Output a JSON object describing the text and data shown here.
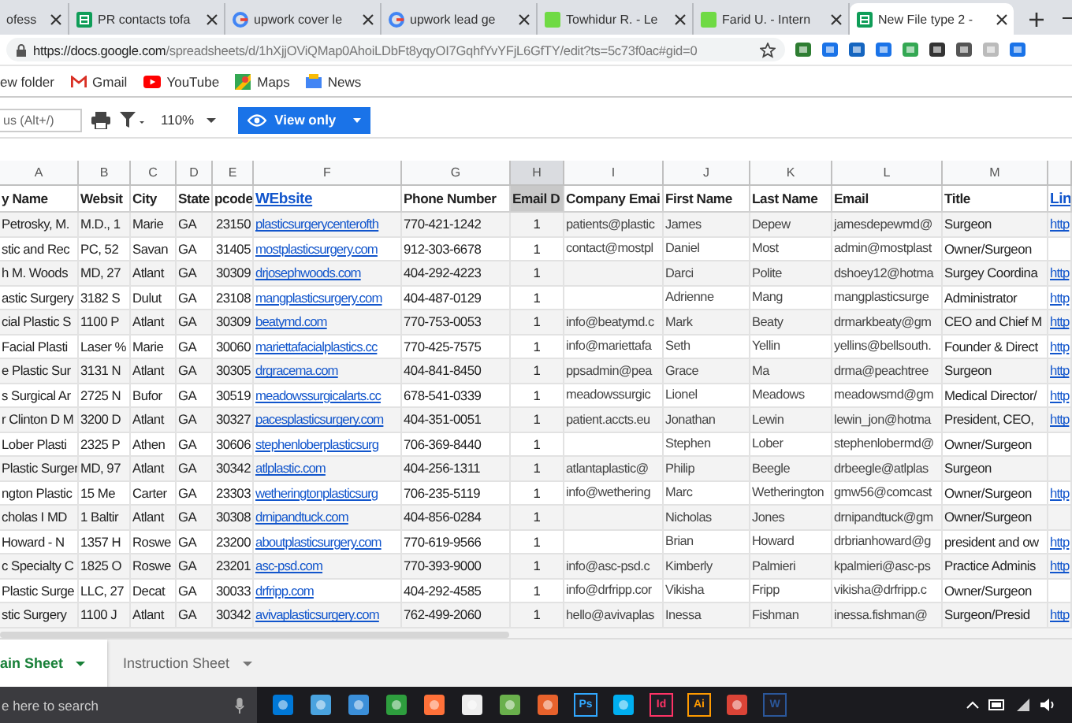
{
  "browser": {
    "tabs": [
      {
        "title": "ofess",
        "kind": "none",
        "selected": false
      },
      {
        "title": "PR contacts tofa",
        "kind": "sheets",
        "selected": false
      },
      {
        "title": "upwork cover le",
        "kind": "google",
        "selected": false
      },
      {
        "title": "upwork lead ge",
        "kind": "google",
        "selected": false
      },
      {
        "title": "Towhidur R. - Le",
        "kind": "upwork",
        "selected": false
      },
      {
        "title": "Farid U. - Intern",
        "kind": "upwork",
        "selected": false
      },
      {
        "title": "New File type 2 -",
        "kind": "sheets",
        "selected": true
      }
    ],
    "url_host": "https://docs.google.com",
    "url_path": "/spreadsheets/d/1hXjjOViQMap0AhoiLDbFt8yqyOI7GqhfYvYFjL6GfTY/edit?ts=5c73f0ac#gid=0",
    "bookmarks": [
      {
        "label": "ew folder",
        "kind": "none"
      },
      {
        "label": "Gmail",
        "kind": "gmail"
      },
      {
        "label": "YouTube",
        "kind": "youtube"
      },
      {
        "label": "Maps",
        "kind": "maps"
      },
      {
        "label": "News",
        "kind": "news"
      }
    ]
  },
  "toolbar": {
    "search_placeholder": "us (Alt+/)",
    "zoom": "110%",
    "view_button": "View only"
  },
  "sheet": {
    "columns": [
      {
        "letter": "A",
        "heading": "y Name",
        "kind": "text",
        "selected": false
      },
      {
        "letter": "B",
        "heading": "Websit",
        "kind": "text",
        "selected": false
      },
      {
        "letter": "C",
        "heading": "City",
        "kind": "text",
        "selected": false
      },
      {
        "letter": "D",
        "heading": "State",
        "kind": "text",
        "selected": false
      },
      {
        "letter": "E",
        "heading": "pcode",
        "kind": "number",
        "selected": false
      },
      {
        "letter": "F",
        "heading": "WEbsite",
        "kind": "link",
        "selected": false
      },
      {
        "letter": "G",
        "heading": "Phone Number",
        "kind": "text",
        "selected": false
      },
      {
        "letter": "H",
        "heading": "Email D",
        "kind": "center",
        "selected": true
      },
      {
        "letter": "I",
        "heading": "Company Emai",
        "kind": "plain",
        "selected": false
      },
      {
        "letter": "J",
        "heading": "First Name",
        "kind": "plain",
        "selected": false
      },
      {
        "letter": "K",
        "heading": "Last Name",
        "kind": "plain",
        "selected": false
      },
      {
        "letter": "L",
        "heading": "Email",
        "kind": "plain",
        "selected": false
      },
      {
        "letter": "M",
        "heading": "Title",
        "kind": "text",
        "selected": false
      },
      {
        "heading": "Lin",
        "kind": "link",
        "selected": false
      }
    ],
    "rows": [
      [
        "Petrosky, M.",
        "M.D., 1",
        "Marie",
        "GA",
        "23150",
        "plasticsurgerycenterofth",
        "770-421-1242",
        "1",
        "patients@plastic",
        "James",
        "Depew",
        "jamesdepewmd@",
        "Surgeon",
        "http"
      ],
      [
        "stic and Rec",
        "PC, 52",
        "Savan",
        "GA",
        "31405",
        "mostplasticsurgery.com",
        "912-303-6678",
        "1",
        "contact@mostpl",
        "Daniel",
        "Most",
        "admin@mostplast",
        "Owner/Surgeon",
        ""
      ],
      [
        "h M. Woods",
        "MD, 27",
        "Atlant",
        "GA",
        "30309",
        "drjosephwoods.com",
        "404-292-4223",
        "1",
        "",
        "Darci",
        "Polite",
        "dshoey12@hotma",
        "Surgey Coordina",
        "http"
      ],
      [
        "astic Surgery",
        "3182 S",
        "Dulut",
        "GA",
        "23108",
        "mangplasticsurgery.com",
        "404-487-0129",
        "1",
        "",
        "Adrienne",
        "Mang",
        "mangplasticsurge",
        "Administrator",
        "http"
      ],
      [
        "cial Plastic S",
        "1100 P",
        "Atlant",
        "GA",
        "30309",
        "beatymd.com",
        "770-753-0053",
        "1",
        "info@beatymd.c",
        "Mark",
        "Beaty",
        "drmarkbeaty@gm",
        "CEO and Chief M",
        "http"
      ],
      [
        "Facial Plasti",
        "Laser %",
        "Marie",
        "GA",
        "30060",
        "mariettafacialplastics.cc",
        "770-425-7575",
        "1",
        "info@mariettafa",
        "Seth",
        "Yellin",
        "yellins@bellsouth.",
        "Founder & Direct",
        "http"
      ],
      [
        "e Plastic Sur",
        "3131 N",
        "Atlant",
        "GA",
        "30305",
        "drgracema.com",
        "404-841-8450",
        "1",
        "ppsadmin@pea",
        "Grace",
        "Ma",
        "drma@peachtree",
        "Surgeon",
        "http"
      ],
      [
        "s Surgical Ar",
        "2725 N",
        "Bufor",
        "GA",
        "30519",
        "meadowssurgicalarts.cc",
        "678-541-0339",
        "1",
        "meadowssurgic",
        "Lionel",
        "Meadows",
        "meadowsmd@gm",
        "Medical Director/",
        "http"
      ],
      [
        "r Clinton D M",
        "3200 D",
        "Atlant",
        "GA",
        "30327",
        "pacesplasticsurgery.com",
        "404-351-0051",
        "1",
        "patient.accts.eu",
        "Jonathan",
        "Lewin",
        "lewin_jon@hotma",
        "President, CEO,",
        "http"
      ],
      [
        "Lober Plasti",
        "2325 P",
        "Athen",
        "GA",
        "30606",
        "stephenloberplasticsurg",
        "706-369-8440",
        "1",
        "",
        "Stephen",
        "Lober",
        "stephenlobermd@",
        "Owner/Surgeon",
        ""
      ],
      [
        "Plastic Surger",
        "MD, 97",
        "Atlant",
        "GA",
        "30342",
        "atlplastic.com",
        "404-256-1311",
        "1",
        "atlantaplastic@",
        "Philip",
        "Beegle",
        "drbeegle@atlplas",
        "Surgeon",
        ""
      ],
      [
        "ngton Plastic",
        "15 Me",
        "Carter",
        "GA",
        "23303",
        "wetheringtonplasticsurg",
        "706-235-5119",
        "1",
        "info@wethering",
        "Marc",
        "Wetherington",
        "gmw56@comcast",
        "Owner/Surgeon",
        "http"
      ],
      [
        "cholas I MD",
        "1 Baltir",
        "Atlant",
        "GA",
        "30308",
        "drnipandtuck.com",
        "404-856-0284",
        "1",
        "",
        "Nicholas",
        "Jones",
        "drnipandtuck@gm",
        "Owner/Surgeon",
        ""
      ],
      [
        "Howard - N",
        "1357 H",
        "Roswe",
        "GA",
        "23200",
        "aboutplasticsurgery.com",
        "770-619-9566",
        "1",
        "",
        "Brian",
        "Howard",
        "drbrianhoward@g",
        "president and ow",
        "http"
      ],
      [
        "c Specialty C",
        "1825 O",
        "Roswe",
        "GA",
        "23201",
        "asc-psd.com",
        "770-393-9000",
        "1",
        "info@asc-psd.c",
        "Kimberly",
        "Palmieri",
        "kpalmieri@asc-ps",
        "Practice Adminis",
        "http"
      ],
      [
        "Plastic Surge",
        "LLC, 27",
        "Decat",
        "GA",
        "30033",
        "drfripp.com",
        "404-292-4585",
        "1",
        "info@drfripp.cor",
        "Vikisha",
        "Fripp",
        "vikisha@drfripp.c",
        "Owner/Surgeon",
        ""
      ],
      [
        "stic Surgery",
        "1100 J",
        "Atlant",
        "GA",
        "30342",
        "avivaplasticsurgery.com",
        "762-499-2060",
        "1",
        "hello@avivaplas",
        "Inessa",
        "Fishman",
        "inessa.fishman@",
        "Surgeon/Presid",
        "http"
      ]
    ],
    "sheet_tabs": [
      {
        "label": "ain Sheet",
        "selected": true
      },
      {
        "label": "Instruction Sheet",
        "selected": false
      }
    ]
  },
  "taskbar": {
    "search_placeholder": "e here to search",
    "apps": [
      {
        "kind": "shape",
        "color": "#0078d7"
      },
      {
        "kind": "shape",
        "color": "#4aa3df"
      },
      {
        "kind": "shape",
        "color": "#3b8fd9"
      },
      {
        "kind": "shape",
        "color": "#2e9e3e"
      },
      {
        "kind": "shape",
        "color": "#ff7139"
      },
      {
        "kind": "shape",
        "color": "#eeeeee"
      },
      {
        "kind": "shape",
        "color": "#6ab04c"
      },
      {
        "kind": "shape",
        "color": "#e8622c"
      },
      {
        "kind": "letters",
        "label": "Ps",
        "color": "#31a8ff"
      },
      {
        "kind": "shape",
        "color": "#00aff0"
      },
      {
        "kind": "letters",
        "label": "Id",
        "color": "#ff3366"
      },
      {
        "kind": "letters",
        "label": "Ai",
        "color": "#ff9a00"
      },
      {
        "kind": "shape",
        "color": "#db4437"
      },
      {
        "kind": "letters",
        "label": "W",
        "color": "#2b579a"
      }
    ]
  }
}
